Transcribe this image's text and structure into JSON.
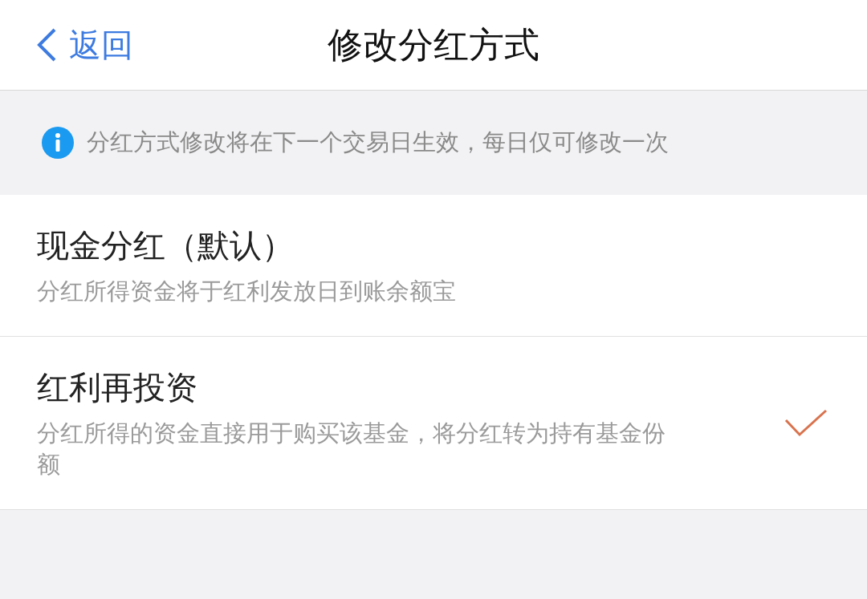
{
  "nav": {
    "back": "返回",
    "title": "修改分红方式"
  },
  "notice": {
    "text": "分红方式修改将在下一个交易日生效，每日仅可修改一次"
  },
  "options": [
    {
      "title": "现金分红（默认）",
      "description": "分红所得资金将于红利发放日到账余额宝",
      "selected": false
    },
    {
      "title": "红利再投资",
      "description": "分红所得的资金直接用于购买该基金，将分红转为持有基金份额",
      "selected": true
    }
  ]
}
